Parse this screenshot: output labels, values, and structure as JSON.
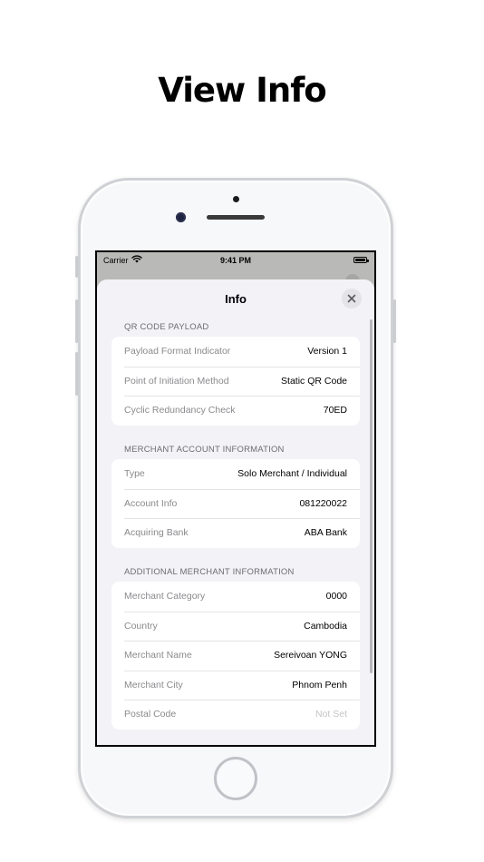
{
  "headline": "View Info",
  "status_bar": {
    "carrier": "Carrier",
    "time": "9:41 PM"
  },
  "sheet": {
    "title": "Info",
    "sections": [
      {
        "header": "QR CODE PAYLOAD",
        "rows": [
          {
            "label": "Payload Format Indicator",
            "value": "Version 1"
          },
          {
            "label": "Point of Initiation Method",
            "value": "Static QR Code"
          },
          {
            "label": "Cyclic Redundancy Check",
            "value": "70ED"
          }
        ]
      },
      {
        "header": "MERCHANT ACCOUNT INFORMATION",
        "rows": [
          {
            "label": "Type",
            "value": "Solo Merchant / Individual"
          },
          {
            "label": "Account Info",
            "value": "081220022"
          },
          {
            "label": "Acquiring Bank",
            "value": "ABA Bank"
          }
        ]
      },
      {
        "header": "ADDITIONAL MERCHANT INFORMATION",
        "rows": [
          {
            "label": "Merchant Category",
            "value": "0000"
          },
          {
            "label": "Country",
            "value": "Cambodia"
          },
          {
            "label": "Merchant Name",
            "value": "Sereivoan YONG"
          },
          {
            "label": "Merchant City",
            "value": "Phnom Penh"
          },
          {
            "label": "Postal Code",
            "value": "Not Set"
          }
        ]
      }
    ]
  },
  "icons": {
    "close": "close-icon",
    "wifi": "wifi-icon",
    "battery": "battery-icon"
  },
  "colors": {
    "sheet_background": "#f2f2f7",
    "card_background": "#ffffff",
    "label_text": "#8a8a8e",
    "value_text": "#000000",
    "placeholder_text": "#c4c4c8"
  }
}
